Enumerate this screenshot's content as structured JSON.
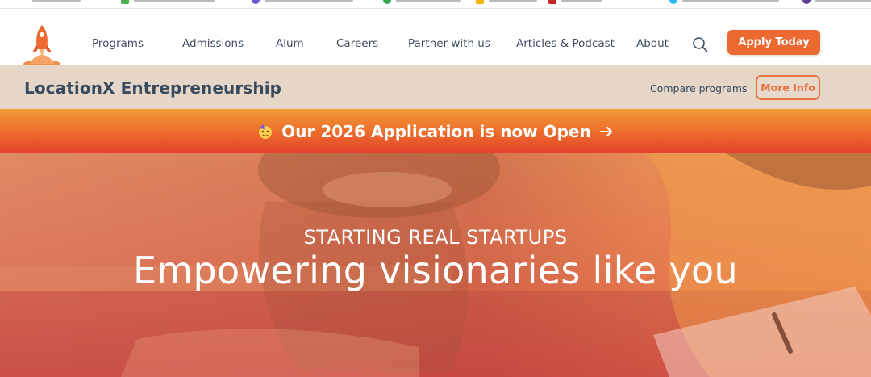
{
  "nav": {
    "links": [
      "Programs",
      "Admissions",
      "Alum",
      "Careers",
      "Partner with us",
      "Articles & Podcast",
      "About"
    ],
    "apply_label": "Apply Today"
  },
  "subnav": {
    "brand": "LocationX Entrepreneurship",
    "compare_label": "Compare programs",
    "more_info_label": "More Info"
  },
  "announcement": {
    "text": "Our 2026 Application is now Open"
  },
  "hero": {
    "kicker": "STARTING REAL STARTUPS",
    "title": "Empowering visionaries like you"
  },
  "colors": {
    "accent": "#ec6a32",
    "nav_text": "#3e4f63",
    "subnav_bg": "#e5d6c8",
    "banner_top": "#f19a35",
    "banner_bottom": "#e4432d"
  }
}
